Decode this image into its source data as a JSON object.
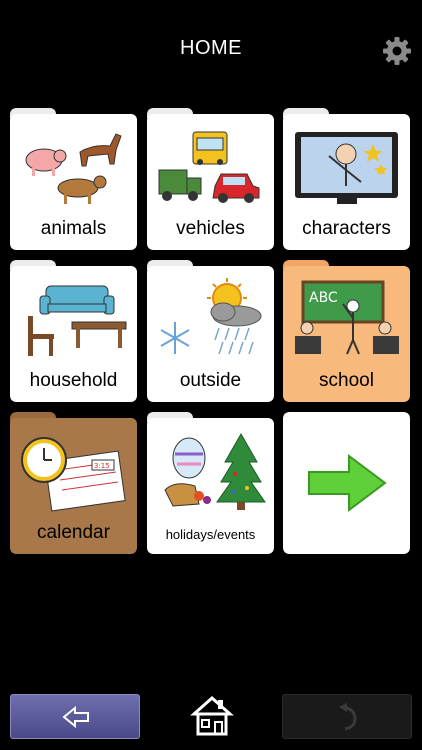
{
  "header": {
    "title": "HOME"
  },
  "icons": {
    "settings": "gear-icon",
    "back": "back-arrow-icon",
    "home": "home-icon",
    "undo": "undo-icon",
    "next": "next-arrow-icon"
  },
  "tiles": [
    {
      "label": "animals",
      "color": "#ffffff"
    },
    {
      "label": "vehicles",
      "color": "#ffffff"
    },
    {
      "label": "characters",
      "color": "#ffffff"
    },
    {
      "label": "household",
      "color": "#ffffff"
    },
    {
      "label": "outside",
      "color": "#ffffff"
    },
    {
      "label": "school",
      "color": "#f7b97c"
    },
    {
      "label": "calendar",
      "color": "#a8784a"
    },
    {
      "label": "holidays/events",
      "color": "#ffffff"
    },
    {
      "label": "",
      "color": "#ffffff"
    }
  ],
  "colors": {
    "accent_green": "#5fcf3a",
    "back_button": "#5a5a9a"
  }
}
